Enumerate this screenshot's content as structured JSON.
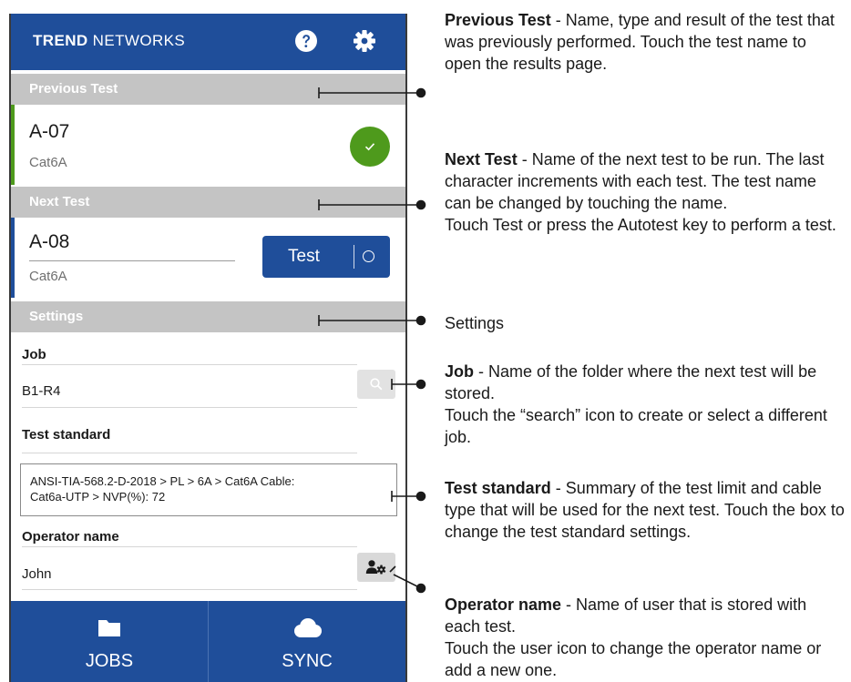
{
  "header": {
    "brand_bold": "TREND",
    "brand_rest": " NETWORKS",
    "help_icon": "question-circle-icon",
    "settings_icon": "gear-icon"
  },
  "previous_test": {
    "section_label": "Previous Test",
    "name": "A-07",
    "type": "Cat6A",
    "result_icon": "check-icon",
    "accent_color": "#4e9a1c"
  },
  "next_test": {
    "section_label": "Next Test",
    "name": "A-08",
    "type": "Cat6A",
    "button_label": "Test",
    "accent_color": "#1f4e9a"
  },
  "settings": {
    "section_label": "Settings",
    "job_label": "Job",
    "job_value": "B1-R4",
    "test_standard_label": "Test standard",
    "test_standard_line1": "ANSI-TIA-568.2-D-2018 > PL > 6A > Cat6A Cable:",
    "test_standard_line2": "Cat6a-UTP > NVP(%): 72",
    "operator_label": "Operator name",
    "operator_value": "John"
  },
  "bottom_nav": {
    "jobs_label": "JOBS",
    "sync_label": "SYNC"
  },
  "descriptions": {
    "previous_title": "Previous Test",
    "previous_text": " - Name, type and result of the test that was previously performed. Touch the test name to open the results page.",
    "next_title": "Next Test",
    "next_text": " - Name of the next test to be run. The last character increments with each test. The test name can be changed by touching the name.",
    "next_text2": "Touch Test or press the Autotest key to perform a test.",
    "settings_title": "Settings",
    "job_title": "Job",
    "job_text": " - Name of the folder where the next test will be stored.",
    "job_text2": "Touch the “search” icon to create or select a different job.",
    "standard_title": "Test standard",
    "standard_text": " - Summary of the test limit and cable type that will be used for the next test. Touch the box to change the test standard settings.",
    "operator_title": "Operator name",
    "operator_text": " - Name of user that is stored with each test.",
    "operator_text2": "Touch the user icon to change the operator name or add a new one."
  },
  "colors": {
    "brand_blue": "#1f4e9a",
    "section_grey": "#c4c4c4",
    "pass_green": "#4e9a1c"
  }
}
